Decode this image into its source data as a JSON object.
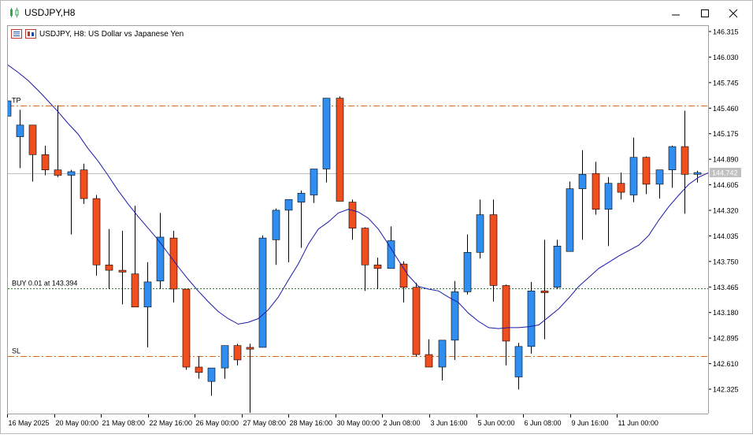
{
  "window": {
    "title": "USDJPY,H8",
    "minimize_label": "minimize",
    "maximize_label": "maximize",
    "close_label": "close"
  },
  "chart_header": {
    "text": "USDJPY, H8:  US Dollar vs Japanese Yen"
  },
  "levels": {
    "tp_label": "TP",
    "tp_price": 145.5,
    "buy_label": "BUY 0.01 at 143.394",
    "buy_price": 143.46,
    "sl_label": "SL",
    "sl_price": 142.7,
    "current_price": 144.742,
    "current_price_label": "144.742"
  },
  "colors": {
    "bull": "#2f8ef0",
    "bear": "#f04e1e",
    "ma": "#1a1aa8",
    "tp_sl": "#d2691e",
    "buy": "#2e7d32",
    "current": "#c0c0c0"
  },
  "chart_data": {
    "type": "candlestick",
    "symbol": "USDJPY",
    "timeframe": "H8",
    "ylim": [
      142.0,
      146.4
    ],
    "y_ticks": [
      "146.315",
      "146.030",
      "145.745",
      "145.460",
      "145.175",
      "144.890",
      "144.605",
      "144.320",
      "144.035",
      "143.750",
      "143.465",
      "143.180",
      "142.895",
      "142.610",
      "142.325"
    ],
    "x_labels": [
      "16 May 2025",
      "20 May 00:00",
      "21 May 08:00",
      "22 May 16:00",
      "26 May 00:00",
      "27 May 08:00",
      "28 May 16:00",
      "30 May 00:00",
      "2 Jun 08:00",
      "3 Jun 16:00",
      "5 Jun 00:00",
      "6 Jun 08:00",
      "9 Jun 16:00",
      "11 Jun 00:00"
    ],
    "candles": [
      {
        "o": 145.38,
        "h": 145.65,
        "l": 145.15,
        "c": 145.55
      },
      {
        "o": 145.15,
        "h": 145.45,
        "l": 144.8,
        "c": 145.28
      },
      {
        "o": 145.28,
        "h": 145.28,
        "l": 144.65,
        "c": 144.95
      },
      {
        "o": 144.95,
        "h": 145.05,
        "l": 144.72,
        "c": 144.78
      },
      {
        "o": 144.78,
        "h": 145.5,
        "l": 144.7,
        "c": 144.72
      },
      {
        "o": 144.72,
        "h": 144.78,
        "l": 144.06,
        "c": 144.76
      },
      {
        "o": 144.78,
        "h": 144.85,
        "l": 144.4,
        "c": 144.46
      },
      {
        "o": 144.46,
        "h": 144.5,
        "l": 143.6,
        "c": 143.72
      },
      {
        "o": 143.72,
        "h": 144.12,
        "l": 143.45,
        "c": 143.66
      },
      {
        "o": 143.66,
        "h": 144.1,
        "l": 143.28,
        "c": 143.64
      },
      {
        "o": 143.62,
        "h": 144.38,
        "l": 143.3,
        "c": 143.25
      },
      {
        "o": 143.25,
        "h": 143.75,
        "l": 142.8,
        "c": 143.53
      },
      {
        "o": 143.54,
        "h": 144.3,
        "l": 143.45,
        "c": 144.03
      },
      {
        "o": 144.02,
        "h": 144.1,
        "l": 143.3,
        "c": 143.45
      },
      {
        "o": 143.45,
        "h": 143.45,
        "l": 142.55,
        "c": 142.58
      },
      {
        "o": 142.58,
        "h": 142.7,
        "l": 142.45,
        "c": 142.52
      },
      {
        "o": 142.42,
        "h": 142.56,
        "l": 142.26,
        "c": 142.57
      },
      {
        "o": 142.57,
        "h": 142.82,
        "l": 142.45,
        "c": 142.82
      },
      {
        "o": 142.82,
        "h": 142.84,
        "l": 142.6,
        "c": 142.66
      },
      {
        "o": 142.8,
        "h": 142.84,
        "l": 142.07,
        "c": 142.78
      },
      {
        "o": 142.8,
        "h": 144.05,
        "l": 142.8,
        "c": 144.02
      },
      {
        "o": 144.0,
        "h": 144.35,
        "l": 143.72,
        "c": 144.33
      },
      {
        "o": 144.33,
        "h": 144.45,
        "l": 143.75,
        "c": 144.45
      },
      {
        "o": 144.42,
        "h": 144.55,
        "l": 143.91,
        "c": 144.52
      },
      {
        "o": 144.5,
        "h": 144.79,
        "l": 144.41,
        "c": 144.79
      },
      {
        "o": 144.79,
        "h": 145.51,
        "l": 144.64,
        "c": 145.58
      },
      {
        "o": 145.58,
        "h": 145.6,
        "l": 144.43,
        "c": 144.43
      },
      {
        "o": 144.42,
        "h": 144.45,
        "l": 144.0,
        "c": 144.13
      },
      {
        "o": 144.13,
        "h": 144.14,
        "l": 143.43,
        "c": 143.72
      },
      {
        "o": 143.72,
        "h": 143.8,
        "l": 143.45,
        "c": 143.68
      },
      {
        "o": 143.68,
        "h": 144.15,
        "l": 143.68,
        "c": 143.99
      },
      {
        "o": 143.73,
        "h": 143.76,
        "l": 143.3,
        "c": 143.47
      },
      {
        "o": 143.47,
        "h": 143.52,
        "l": 142.7,
        "c": 142.72
      },
      {
        "o": 142.72,
        "h": 142.89,
        "l": 142.59,
        "c": 142.58
      },
      {
        "o": 142.58,
        "h": 142.77,
        "l": 142.43,
        "c": 142.88
      },
      {
        "o": 142.88,
        "h": 143.54,
        "l": 142.66,
        "c": 143.42
      },
      {
        "o": 143.42,
        "h": 144.06,
        "l": 143.39,
        "c": 143.86
      },
      {
        "o": 143.86,
        "h": 144.45,
        "l": 143.79,
        "c": 144.28
      },
      {
        "o": 144.28,
        "h": 144.45,
        "l": 143.31,
        "c": 143.49
      },
      {
        "o": 143.49,
        "h": 143.5,
        "l": 142.6,
        "c": 142.87
      },
      {
        "o": 142.47,
        "h": 142.85,
        "l": 142.33,
        "c": 142.81
      },
      {
        "o": 142.81,
        "h": 143.53,
        "l": 142.73,
        "c": 143.43
      },
      {
        "o": 143.43,
        "h": 144.0,
        "l": 142.89,
        "c": 143.41
      },
      {
        "o": 143.47,
        "h": 144.0,
        "l": 143.45,
        "c": 143.93
      },
      {
        "o": 143.87,
        "h": 144.65,
        "l": 143.87,
        "c": 144.57
      },
      {
        "o": 144.57,
        "h": 145.0,
        "l": 144.0,
        "c": 144.73
      },
      {
        "o": 144.74,
        "h": 144.87,
        "l": 144.28,
        "c": 144.34
      },
      {
        "o": 144.34,
        "h": 144.7,
        "l": 143.93,
        "c": 144.63
      },
      {
        "o": 144.63,
        "h": 144.75,
        "l": 144.45,
        "c": 144.53
      },
      {
        "o": 144.5,
        "h": 145.14,
        "l": 144.42,
        "c": 144.92
      },
      {
        "o": 144.92,
        "h": 144.93,
        "l": 144.51,
        "c": 144.62
      },
      {
        "o": 144.62,
        "h": 144.78,
        "l": 144.46,
        "c": 144.78
      },
      {
        "o": 144.78,
        "h": 145.05,
        "l": 144.58,
        "c": 145.04
      },
      {
        "o": 145.04,
        "h": 145.44,
        "l": 144.29,
        "c": 144.73
      },
      {
        "o": 144.73,
        "h": 144.77,
        "l": 144.64,
        "c": 144.75
      }
    ],
    "ma_values": [
      145.95,
      145.87,
      145.78,
      145.67,
      145.55,
      145.43,
      145.3,
      145.18,
      145.02,
      144.88,
      144.72,
      144.55,
      144.4,
      144.26,
      144.13,
      144.0,
      143.85,
      143.7,
      143.56,
      143.43,
      143.31,
      143.2,
      143.12,
      143.06,
      143.08,
      143.12,
      143.22,
      143.36,
      143.55,
      143.73,
      143.95,
      144.12,
      144.2,
      144.3,
      144.34,
      144.31,
      144.24,
      144.12,
      143.95,
      143.77,
      143.6,
      143.48,
      143.45,
      143.43,
      143.36,
      143.3,
      143.18,
      143.09,
      143.02,
      143.01,
      143.02,
      143.02,
      143.03,
      143.05,
      143.14,
      143.23,
      143.35,
      143.48,
      143.58,
      143.68,
      143.75,
      143.82,
      143.88,
      143.94,
      144.05,
      144.22,
      144.37,
      144.5,
      144.62,
      144.7,
      144.75
    ]
  }
}
